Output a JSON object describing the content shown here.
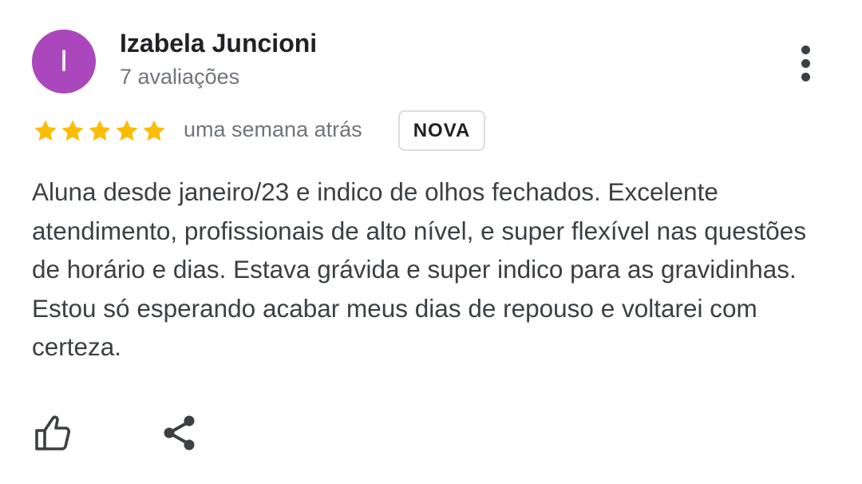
{
  "review": {
    "avatar_initial": "I",
    "avatar_color": "#ab47bc",
    "reviewer_name": "Izabela Juncioni",
    "review_count": "7 avaliações",
    "rating": 5,
    "rating_max": 5,
    "star_color": "#fbbc04",
    "date": "uma semana atrás",
    "badge": "NOVA",
    "text": "Aluna desde janeiro/23 e indico de olhos fechados. Excelente atendimento, profissionais de alto nível, e super flexível nas questões de horário e dias. Estava grávida e super indico para as gravidinhas. Estou só esperando acabar meus dias de repouso e voltarei com certeza."
  },
  "actions": {
    "menu_icon": "more-vert-icon",
    "like_icon": "thumbs-up-icon",
    "share_icon": "share-icon"
  }
}
